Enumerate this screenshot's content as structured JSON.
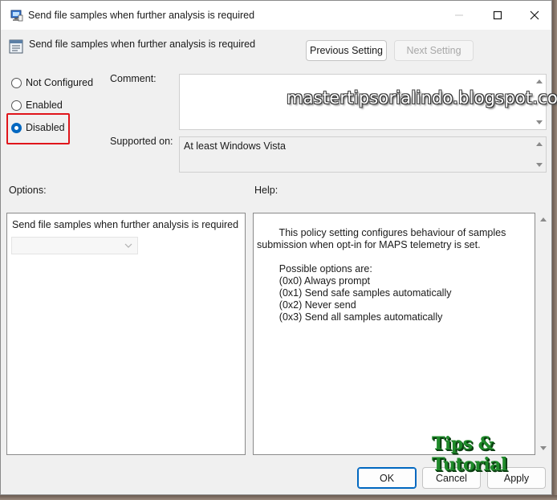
{
  "window": {
    "title": "Send file samples when further analysis is required",
    "controls": {
      "minimize": "minimize",
      "maximize": "maximize",
      "close": "close"
    }
  },
  "header": {
    "policy_name": "Send file samples when further analysis is required",
    "previous_label": "Previous Setting",
    "next_label": "Next Setting"
  },
  "state": {
    "options": [
      {
        "label": "Not Configured",
        "checked": false
      },
      {
        "label": "Enabled",
        "checked": false
      },
      {
        "label": "Disabled",
        "checked": true
      }
    ]
  },
  "comment": {
    "label": "Comment:",
    "value": ""
  },
  "supported": {
    "label": "Supported on:",
    "value": "At least Windows Vista"
  },
  "options_section": {
    "label": "Options:",
    "setting_label": "Send file samples when further analysis is required",
    "dropdown_value": ""
  },
  "help_section": {
    "label": "Help:",
    "text": "        This policy setting configures behaviour of samples\nsubmission when opt-in for MAPS telemetry is set.\n\n        Possible options are:\n        (0x0) Always prompt\n        (0x1) Send safe samples automatically\n        (0x2) Never send\n        (0x3) Send all samples automatically"
  },
  "footer": {
    "ok_label": "OK",
    "cancel_label": "Cancel",
    "apply_label": "Apply"
  },
  "overlays": {
    "watermark": "mastertipsorialindo.blogspot.com",
    "logo": "Tips & Tutorial"
  },
  "colors": {
    "accent": "#0067c0",
    "highlight": "#e0151b",
    "logo": "#1f8a2a"
  }
}
